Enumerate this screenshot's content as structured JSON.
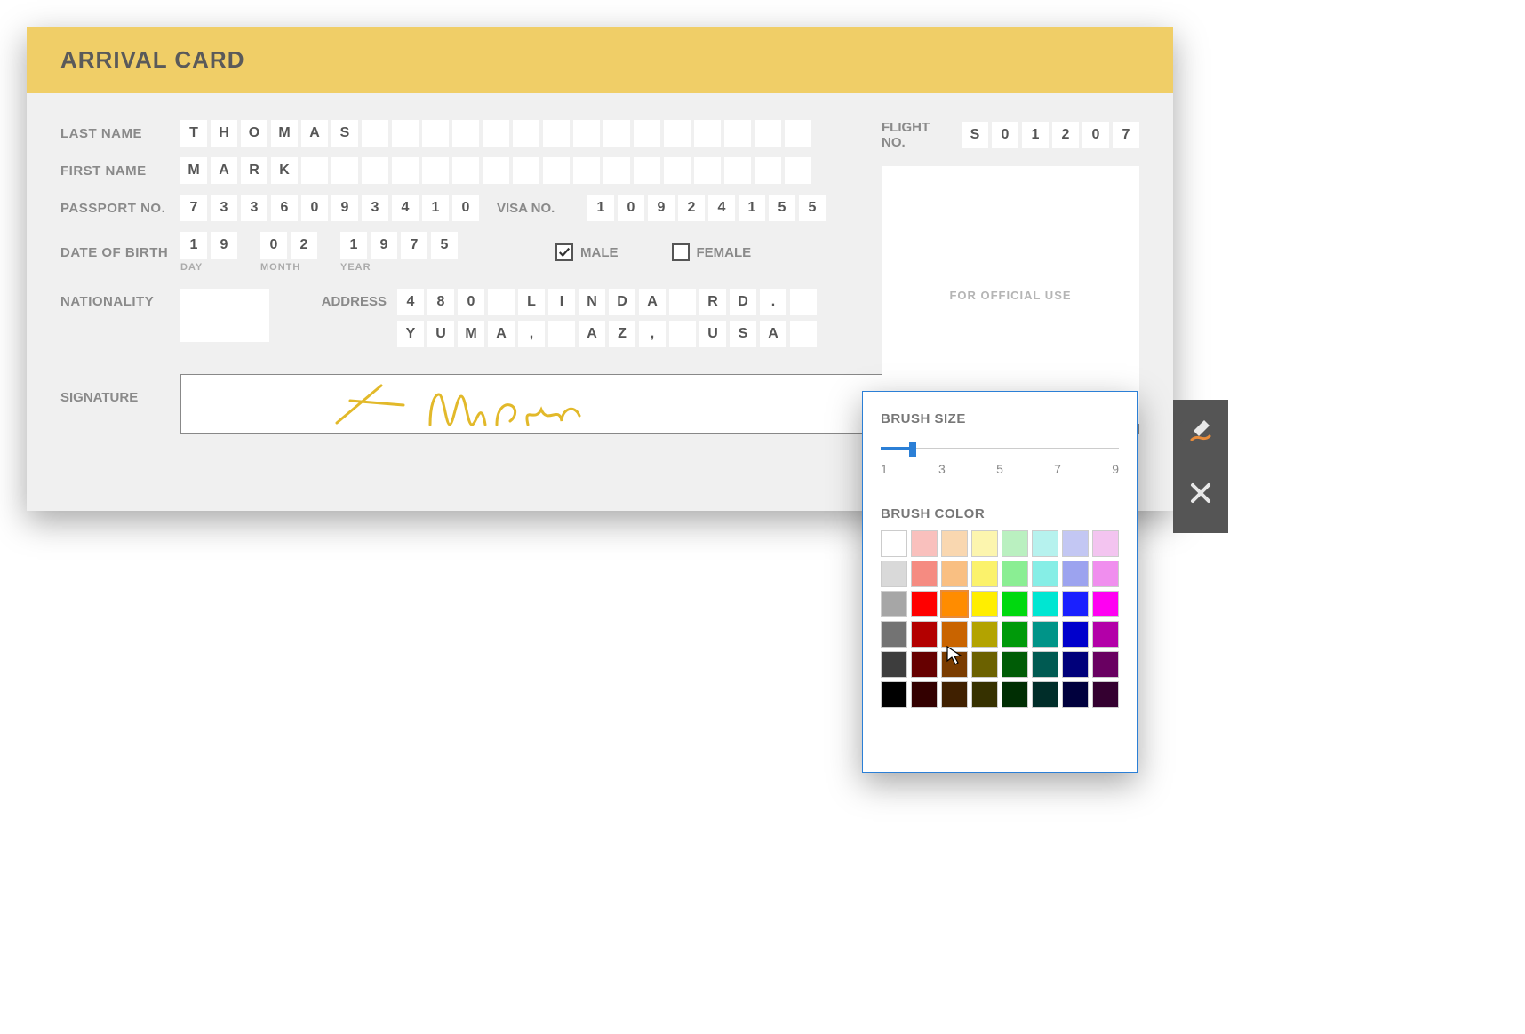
{
  "header": {
    "title": "ARRIVAL CARD"
  },
  "labels": {
    "last_name": "LAST NAME",
    "first_name": "FIRST NAME",
    "passport": "PASSPORT NO.",
    "visa": "VISA NO.",
    "dob": "DATE OF BIRTH",
    "day": "DAY",
    "month": "MONTH",
    "year": "YEAR",
    "male": "MALE",
    "female": "FEMALE",
    "nationality": "NATIONALITY",
    "address": "ADDRESS",
    "signature": "SIGNATURE",
    "flight": "FLIGHT NO.",
    "official": "FOR OFFICIAL USE"
  },
  "fields": {
    "last_name": [
      "T",
      "H",
      "O",
      "M",
      "A",
      "S",
      "",
      "",
      "",
      "",
      "",
      "",
      "",
      "",
      "",
      "",
      "",
      "",
      "",
      "",
      ""
    ],
    "first_name": [
      "M",
      "A",
      "R",
      "K",
      "",
      "",
      "",
      "",
      "",
      "",
      "",
      "",
      "",
      "",
      "",
      "",
      "",
      "",
      "",
      "",
      ""
    ],
    "passport": [
      "7",
      "3",
      "3",
      "6",
      "0",
      "9",
      "3",
      "4",
      "1",
      "0"
    ],
    "visa": [
      "1",
      "0",
      "9",
      "2",
      "4",
      "1",
      "5",
      "5"
    ],
    "dob_day": [
      "1",
      "9"
    ],
    "dob_month": [
      "0",
      "2"
    ],
    "dob_year": [
      "1",
      "9",
      "7",
      "5"
    ],
    "male_checked": true,
    "female_checked": false,
    "address_line1": [
      "4",
      "8",
      "0",
      "",
      "L",
      "I",
      "N",
      "D",
      "A",
      "",
      "R",
      "D",
      ".",
      ""
    ],
    "address_line2": [
      "Y",
      "U",
      "M",
      "A",
      ",",
      "",
      "A",
      "Z",
      ",",
      "",
      "U",
      "S",
      "A",
      ""
    ],
    "flight": [
      "S",
      "0",
      "1",
      "2",
      "0",
      "7"
    ]
  },
  "popup": {
    "brush_size_label": "BRUSH SIZE",
    "brush_color_label": "BRUSH COLOR",
    "ticks": [
      "1",
      "3",
      "5",
      "7",
      "9"
    ],
    "slider_value": 1,
    "selected_color_index": 18,
    "colors": [
      "#ffffff",
      "#f9c0bd",
      "#f9d7b0",
      "#fcf5ae",
      "#baf0c0",
      "#b6f2ee",
      "#c3c7f3",
      "#f3c4f0",
      "#d9d9d9",
      "#f58b81",
      "#f9bf82",
      "#fbf26b",
      "#8aee93",
      "#86eee6",
      "#9ca3ef",
      "#f08eee",
      "#a6a6a6",
      "#ff0000",
      "#ff8c00",
      "#ffee00",
      "#00d90f",
      "#00e6d2",
      "#1a20ff",
      "#ff00f2",
      "#737373",
      "#b30000",
      "#c96400",
      "#b3a300",
      "#009a0a",
      "#009488",
      "#0000cc",
      "#b300a8",
      "#3d3d3d",
      "#660000",
      "#7a3c00",
      "#6b6100",
      "#005c06",
      "#005a52",
      "#00007a",
      "#690061",
      "#000000",
      "#330000",
      "#402000",
      "#363100",
      "#002e03",
      "#002d29",
      "#00003d",
      "#340030"
    ]
  }
}
